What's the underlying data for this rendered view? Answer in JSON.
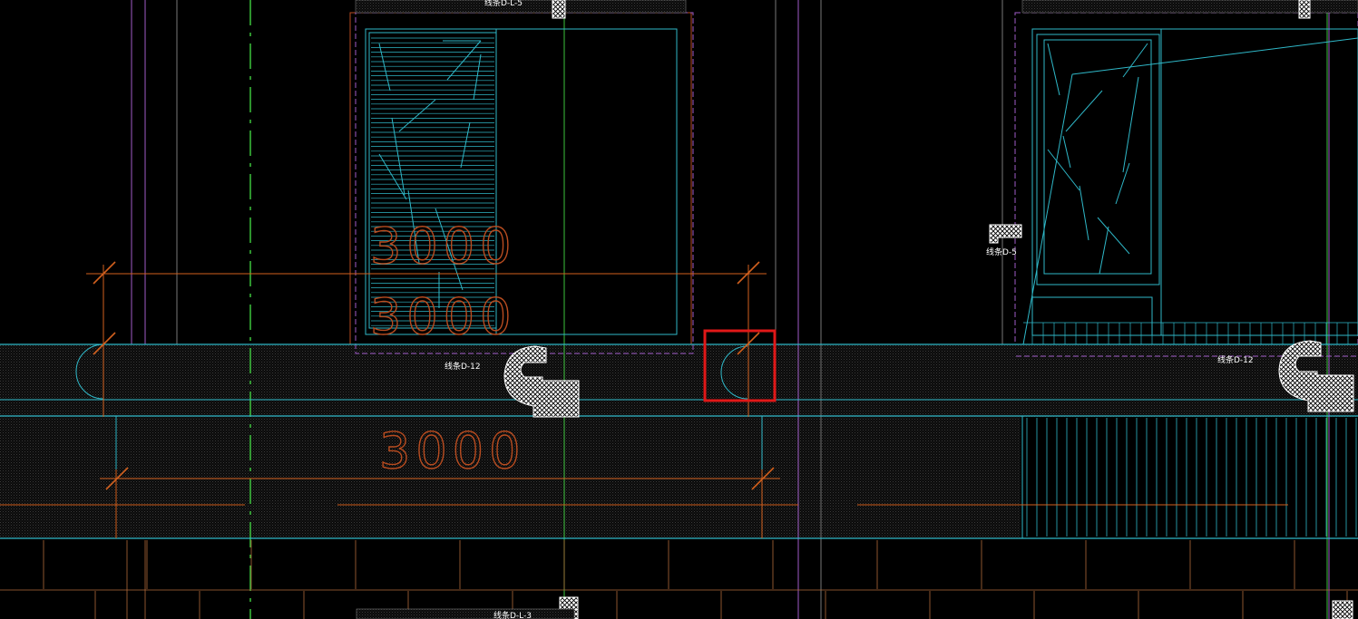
{
  "drawing": {
    "dimensions": {
      "upper_1": "3000",
      "upper_2": "3000",
      "lower": "3000"
    },
    "tags": {
      "top_center": "线条D-L-5",
      "bar_left": "线条D-12",
      "bar_right": "线条D-12",
      "side_right": "线条D-5",
      "bottom_center": "线条D-L-3"
    },
    "colors": {
      "background": "#000000",
      "cyan": "#2fb8c8",
      "green": "#3cc23c",
      "orange": "#d2601e",
      "magenta": "#a05cc8",
      "highlight": "#e01818"
    }
  }
}
